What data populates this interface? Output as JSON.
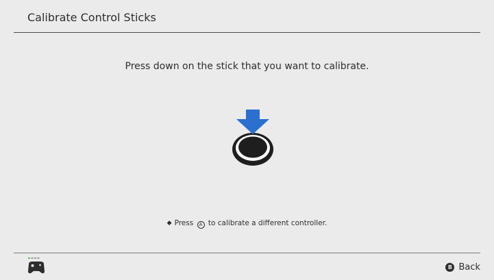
{
  "header": {
    "title": "Calibrate Control Sticks"
  },
  "main": {
    "instruction": "Press down on the stick that you want to calibrate.",
    "graphic_icon": "stick-press-down-icon",
    "hint_prefix": "Press",
    "hint_button": "A",
    "hint_suffix": "to calibrate a different controller."
  },
  "footer": {
    "controller_icon": "controller-icon",
    "back_button_glyph": "B",
    "back_label": "Back"
  },
  "colors": {
    "background": "#ebebeb",
    "arrow_blue": "#2b6fcf",
    "player_led_green": "#63c23a",
    "text": "#2d2d2d"
  }
}
